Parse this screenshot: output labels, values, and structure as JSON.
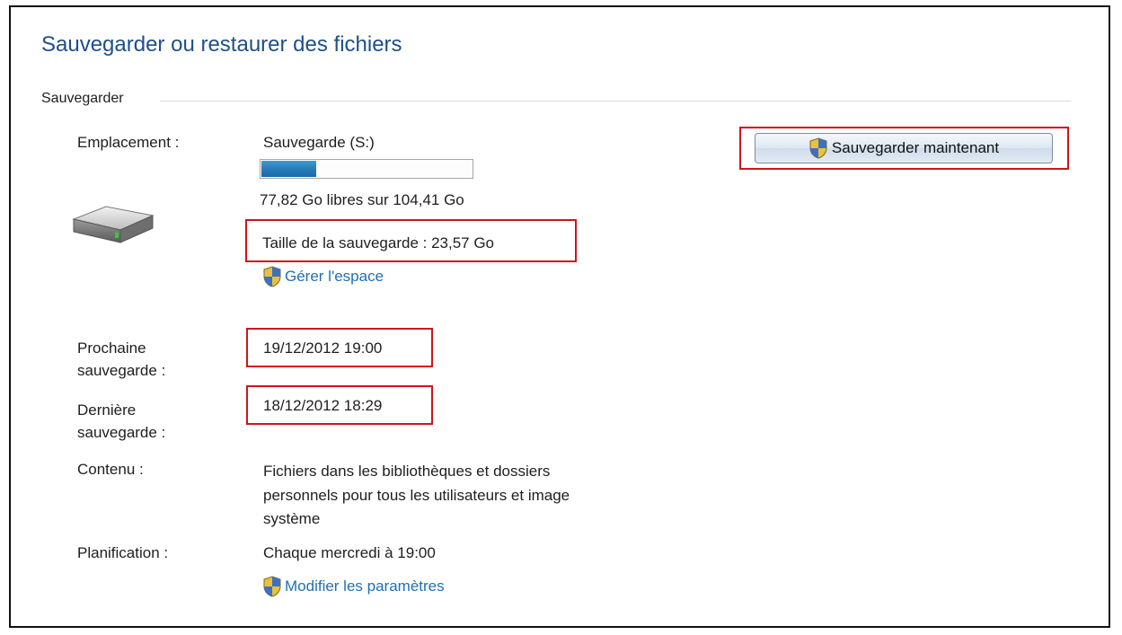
{
  "title": "Sauvegarder ou restaurer des fichiers",
  "section": "Sauvegarder",
  "location": {
    "label": "Emplacement :",
    "drive_name": "Sauvegarde (S:)",
    "usage_fraction": 0.26,
    "free_space": "77,82 Go libres sur 104,41 Go",
    "backup_size": "Taille de la sauvegarde : 23,57 Go",
    "manage_link": "Gérer l'espace"
  },
  "backup_button": "Sauvegarder maintenant",
  "next_backup": {
    "label_line1": "Prochaine",
    "label_line2": "sauvegarde :",
    "value": "19/12/2012 19:00"
  },
  "last_backup": {
    "label_line1": "Dernière",
    "label_line2": "sauvegarde :",
    "value": "18/12/2012 18:29"
  },
  "contents": {
    "label": "Contenu :",
    "line1": "Fichiers dans les bibliothèques et dossiers",
    "line2": "personnels pour tous les utilisateurs et image",
    "line3": "système"
  },
  "schedule": {
    "label": "Planification :",
    "value": "Chaque mercredi à 19:00",
    "change_link": "Modifier les paramètres"
  },
  "colors": {
    "title": "#1f4f8a",
    "link": "#1f6fb5",
    "highlight": "#d0141c",
    "progress": "#2b7db7"
  },
  "icons": {
    "drive": "hard-drive-icon",
    "uac": "uac-shield-icon"
  }
}
